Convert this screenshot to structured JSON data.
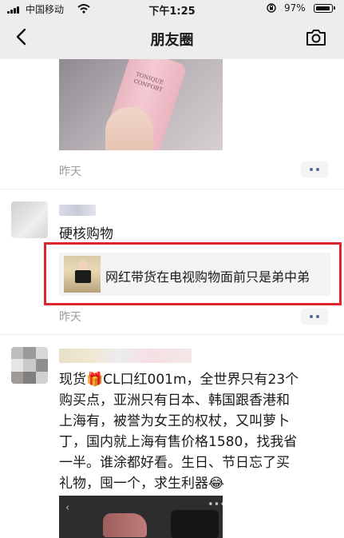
{
  "status_bar": {
    "carrier": "中国移动",
    "time": "下午1:25",
    "battery_percent": "97%",
    "battery_level": 0.97
  },
  "nav": {
    "title": "朋友圈"
  },
  "posts": [
    {
      "time": "昨天"
    },
    {
      "text": "硬核购物",
      "link_title": "网红带货在电视购物面前只是弟中弟",
      "time": "昨天"
    },
    {
      "text_lines": [
        "现货🎁CL口红001m，全世界只有23个",
        "购买点，亚洲只有日本、韩国跟香港和",
        "上海有，被誉为女王的权杖，又叫萝卜",
        "丁，国内就上海有售价格1580，找我省",
        "一半。谁涂都好看。生日、节日忘了买",
        "礼物，囤一个，求生利器😂"
      ]
    }
  ],
  "photo1_label": "TONIQUE CONFORT",
  "colors": {
    "nav_bg": "#ededed",
    "link_blue": "#576b95",
    "highlight_red": "#e0262c"
  }
}
